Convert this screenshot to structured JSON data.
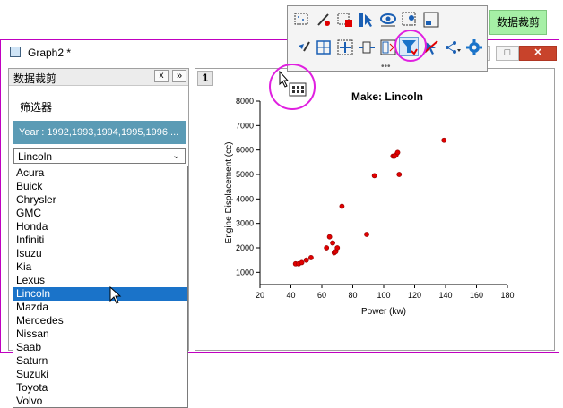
{
  "window": {
    "title": "Graph2 *",
    "min_label": "–",
    "max_label": "□",
    "close_label": "✕"
  },
  "panel": {
    "title": "数据裁剪",
    "close_label": "x",
    "more_label": "»",
    "filter_label": "筛选器",
    "year_text": "Year : 1992,1993,1994,1995,1996,...",
    "make_selected": "Lincoln",
    "make_options": [
      "Acura",
      "Buick",
      "Chrysler",
      "GMC",
      "Honda",
      "Infiniti",
      "Isuzu",
      "Kia",
      "Lexus",
      "Lincoln",
      "Mazda",
      "Mercedes",
      "Nissan",
      "Saab",
      "Saturn",
      "Suzuki",
      "Toyota",
      "Volvo"
    ]
  },
  "graph": {
    "layer_label": "1"
  },
  "toolbar": {
    "row1": [
      "select-region-icon",
      "edit-brush-icon",
      "select-data-icon",
      "pointer-icon",
      "show-icon",
      "reader-icon",
      "zoom-icon"
    ],
    "row2": [
      "arrow-brush-icon",
      "grid-icon",
      "move-icon",
      "scale-icon",
      "panel-icon",
      "filter-icon",
      "clear-icon",
      "dropdown-icon",
      "settings-icon"
    ],
    "dots": "•••"
  },
  "crop_button": {
    "label": "数据裁剪"
  },
  "chart_data": {
    "type": "scatter",
    "title": "Make: Lincoln",
    "xlabel": "Power (kw)",
    "ylabel": "Engine Displacement (cc)",
    "xlim": [
      20,
      180
    ],
    "ylim": [
      500,
      8000
    ],
    "xticks": [
      20,
      40,
      60,
      80,
      100,
      120,
      140,
      160,
      180
    ],
    "yticks": [
      1000,
      2000,
      3000,
      4000,
      5000,
      6000,
      7000,
      8000
    ],
    "marker_color": "#e00000",
    "x": [
      43,
      45,
      47,
      50,
      53,
      63,
      65,
      67,
      68,
      69,
      70,
      73,
      89,
      94,
      106,
      107,
      108,
      109,
      110,
      139
    ],
    "y": [
      1350,
      1350,
      1400,
      1500,
      1600,
      2000,
      2450,
      2200,
      1800,
      1850,
      2000,
      3700,
      2550,
      4950,
      5750,
      5750,
      5800,
      5900,
      5000,
      6400
    ]
  }
}
